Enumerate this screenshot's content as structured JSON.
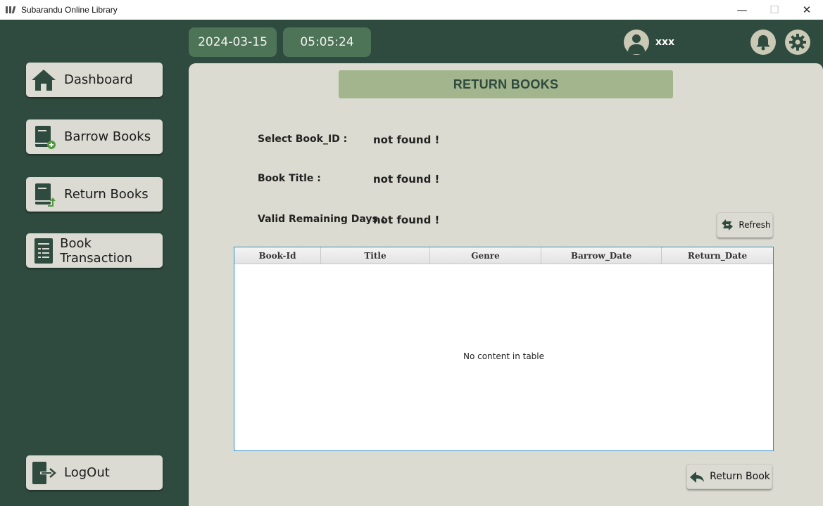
{
  "window": {
    "title": "Subarandu Online Library",
    "controls": {
      "minimize": "—",
      "maximize": "☐",
      "close": "✕"
    }
  },
  "header": {
    "date": "2024-03-15",
    "time": "05:05:24",
    "username": "xxx",
    "icons": [
      "user-avatar-icon",
      "bell-icon",
      "gear-icon"
    ]
  },
  "sidebar": {
    "items": [
      {
        "label": "Dashboard",
        "icon": "home-icon"
      },
      {
        "label": "Barrow Books",
        "icon": "book-add-icon"
      },
      {
        "label": "Return Books",
        "icon": "book-return-icon"
      },
      {
        "label": "Book Transaction",
        "icon": "document-list-icon"
      }
    ],
    "logout": {
      "label": "LogOut",
      "icon": "logout-icon"
    }
  },
  "main": {
    "title": "RETURN BOOKS",
    "fields": [
      {
        "label": "Select Book_ID :",
        "value": "not found !"
      },
      {
        "label": "Book Title :",
        "value": "not found !"
      },
      {
        "label": "Valid Remaining Days :",
        "value": "not found !"
      }
    ],
    "refresh_label": "Refresh",
    "table": {
      "columns": [
        "Book-Id",
        "Title",
        "Genre",
        "Barrow_Date",
        "Return_Date"
      ],
      "rows": [],
      "empty_text": "No content in table"
    },
    "return_label": "Return Book"
  },
  "colors": {
    "sidebar_bg": "#2f4a3e",
    "pill_bg": "#4d7456",
    "panel_bg": "#dcdbd1",
    "title_bg": "#a2b58c",
    "table_border": "#2a8dc8"
  }
}
